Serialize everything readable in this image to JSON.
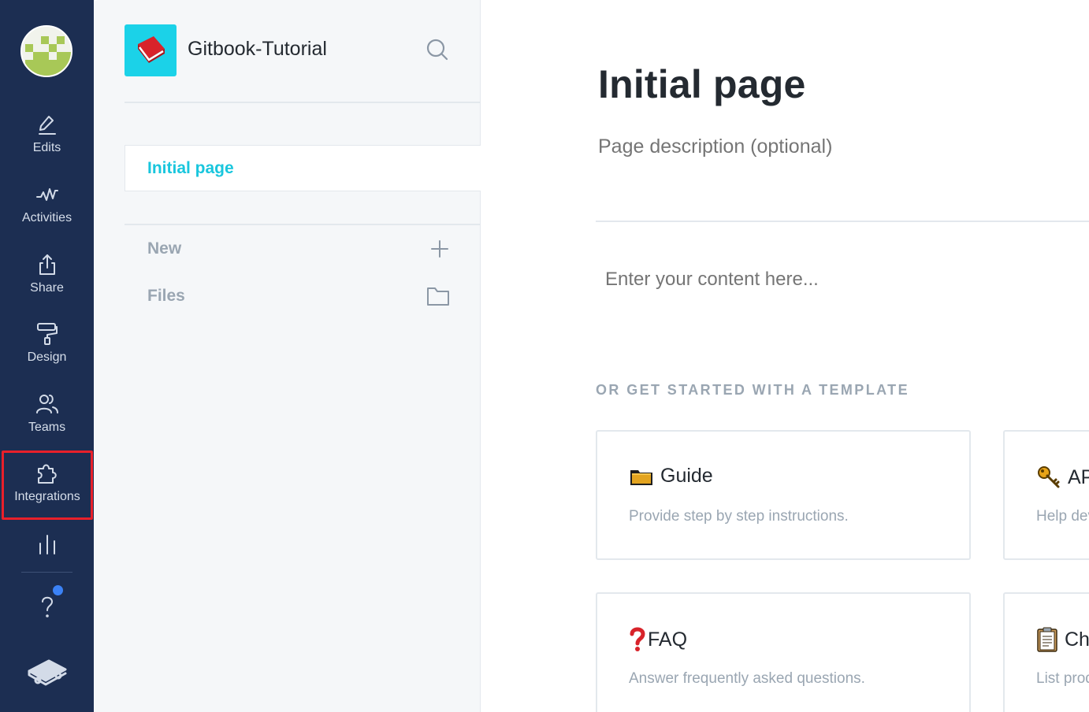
{
  "rail": {
    "items": [
      {
        "label": "Edits",
        "icon": "edit-icon"
      },
      {
        "label": "Activities",
        "icon": "activity-icon"
      },
      {
        "label": "Share",
        "icon": "share-icon"
      },
      {
        "label": "Design",
        "icon": "paint-roller-icon"
      },
      {
        "label": "Teams",
        "icon": "teams-icon"
      },
      {
        "label": "Integrations",
        "icon": "puzzle-icon"
      }
    ],
    "analytics_icon": "bar-chart-icon",
    "help_icon": "help-icon",
    "bottom_icon": "gitbook-logo-icon",
    "highlight_color": "#e8202a",
    "help_dot_color": "#3b82f6"
  },
  "panel": {
    "space_title": "Gitbook-Tutorial",
    "space_icon": "red-book-icon",
    "pages": [
      {
        "label": "Initial page"
      }
    ],
    "actions": [
      {
        "label": "New",
        "icon": "plus-icon"
      },
      {
        "label": "Files",
        "icon": "folder-icon"
      }
    ]
  },
  "main": {
    "title": "Initial page",
    "description_placeholder": "Page description (optional)",
    "content_placeholder": "Enter your content here...",
    "template_heading": "OR GET STARTED WITH A TEMPLATE",
    "templates": [
      {
        "emoji": "folder-emoji",
        "title": "Guide",
        "description": "Provide step by step instructions."
      },
      {
        "emoji": "key-emoji",
        "title": "API Reference",
        "description": "Help developers use your API."
      },
      {
        "emoji": "question-emoji",
        "title": "FAQ",
        "description": "Answer frequently asked questions."
      },
      {
        "emoji": "clipboard-emoji",
        "title": "Changelog",
        "description": "List product changes."
      }
    ]
  },
  "colors": {
    "rail_bg": "#1c2e52",
    "accent": "#19c6dd",
    "muted_text": "#9aa6b2",
    "heading_text": "#242a31"
  }
}
